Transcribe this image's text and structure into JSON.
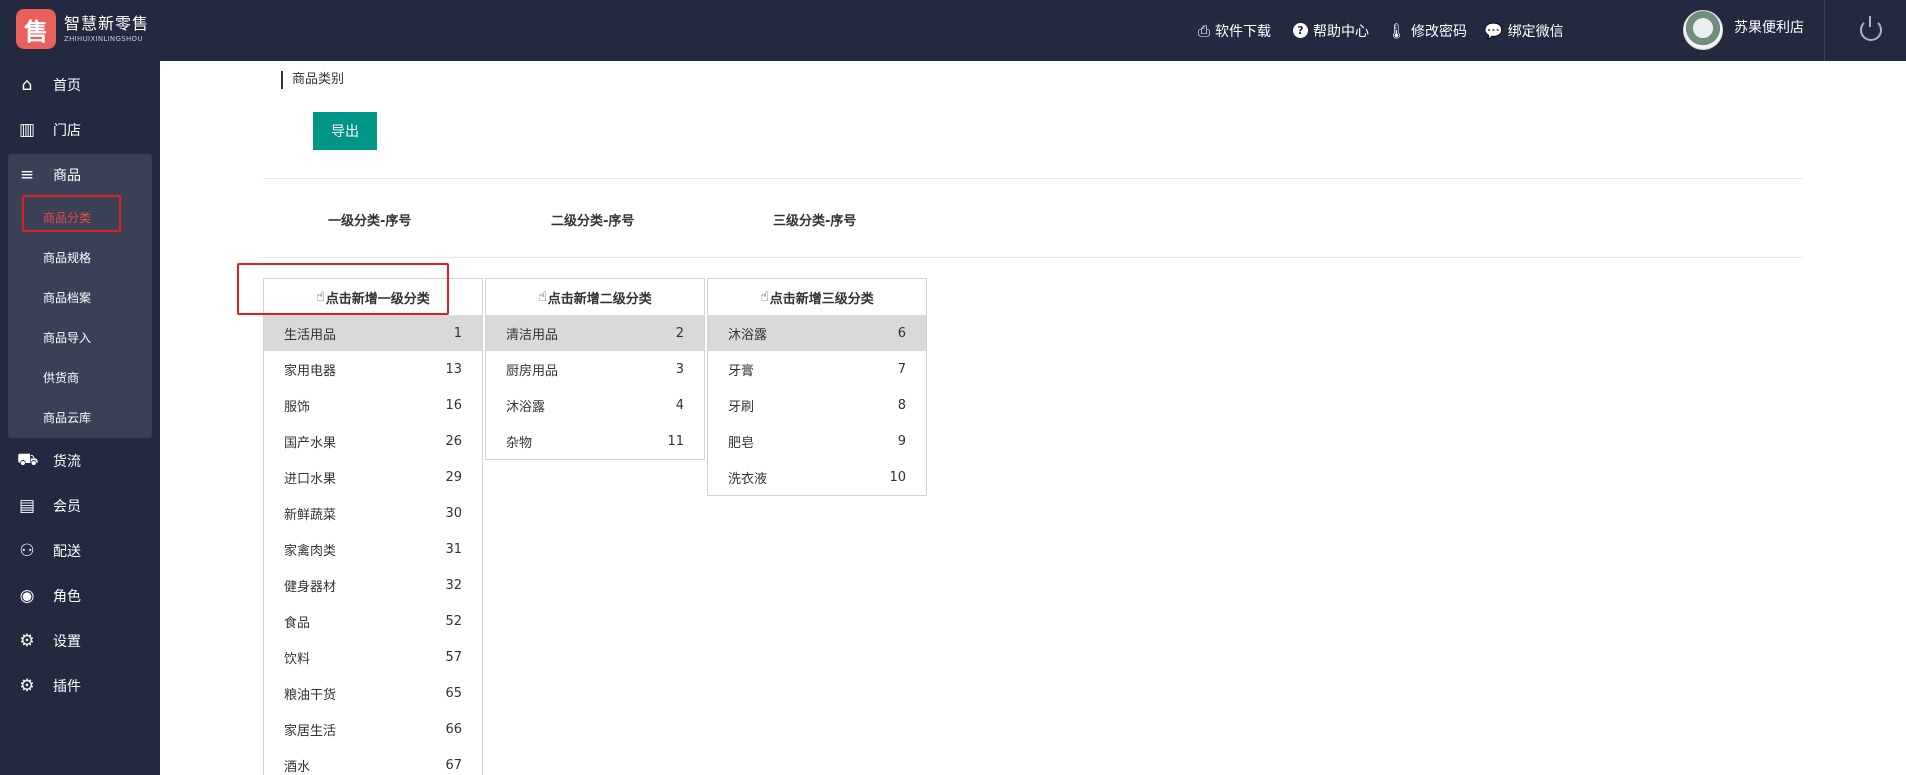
{
  "header": {
    "logo_glyph": "售",
    "logo_cn": "智慧新零售",
    "logo_en": "ZHIHUIXINLINGSHOU",
    "menu": [
      {
        "icon": "printer-icon",
        "label": "软件下载"
      },
      {
        "icon": "help-icon",
        "label": "帮助中心"
      },
      {
        "icon": "thermometer-icon",
        "label": "修改密码"
      },
      {
        "icon": "wechat-icon",
        "label": "绑定微信"
      }
    ],
    "store_name": "苏果便利店"
  },
  "sidebar": {
    "items": [
      {
        "icon": "home-icon",
        "label": "首页"
      },
      {
        "icon": "building-icon",
        "label": "门店"
      },
      {
        "icon": "list-icon",
        "label": "商品"
      },
      {
        "icon": "truck-icon",
        "label": "货流"
      },
      {
        "icon": "id-card-icon",
        "label": "会员"
      },
      {
        "icon": "motorcycle-icon",
        "label": "配送"
      },
      {
        "icon": "user-circle-icon",
        "label": "角色"
      },
      {
        "icon": "gear-icon",
        "label": "设置"
      },
      {
        "icon": "gears-icon",
        "label": "插件"
      }
    ],
    "sub_items": [
      "商品分类",
      "商品规格",
      "商品档案",
      "商品导入",
      "供货商",
      "商品云库"
    ],
    "active_sub": "商品分类"
  },
  "main": {
    "breadcrumb": "商品类别",
    "export_label": "导出",
    "column_headers": [
      "一级分类-序号",
      "二级分类-序号",
      "三级分类-序号"
    ],
    "level1": {
      "add_label": "点击新增一级分类",
      "rows": [
        {
          "name": "生活用品",
          "seq": "1",
          "selected": true
        },
        {
          "name": "家用电器",
          "seq": "13"
        },
        {
          "name": "服饰",
          "seq": "16"
        },
        {
          "name": "国产水果",
          "seq": "26"
        },
        {
          "name": "进口水果",
          "seq": "29"
        },
        {
          "name": "新鲜蔬菜",
          "seq": "30"
        },
        {
          "name": "家禽肉类",
          "seq": "31"
        },
        {
          "name": "健身器材",
          "seq": "32"
        },
        {
          "name": "食品",
          "seq": "52"
        },
        {
          "name": "饮料",
          "seq": "57"
        },
        {
          "name": "粮油干货",
          "seq": "65"
        },
        {
          "name": "家居生活",
          "seq": "66"
        },
        {
          "name": "酒水",
          "seq": "67"
        }
      ]
    },
    "level2": {
      "add_label": "点击新增二级分类",
      "rows": [
        {
          "name": "清洁用品",
          "seq": "2",
          "selected": true
        },
        {
          "name": "厨房用品",
          "seq": "3"
        },
        {
          "name": "沐浴露",
          "seq": "4"
        },
        {
          "name": "杂物",
          "seq": "11"
        }
      ]
    },
    "level3": {
      "add_label": "点击新增三级分类",
      "rows": [
        {
          "name": "沐浴露",
          "seq": "6",
          "selected": true
        },
        {
          "name": "牙膏",
          "seq": "7"
        },
        {
          "name": "牙刷",
          "seq": "8"
        },
        {
          "name": "肥皂",
          "seq": "9"
        },
        {
          "name": "洗衣液",
          "seq": "10"
        }
      ]
    }
  },
  "colors": {
    "nav_bg": "#232a40",
    "accent": "#009688",
    "highlight_red": "#e02020",
    "selected_row": "#d9d9d9"
  }
}
